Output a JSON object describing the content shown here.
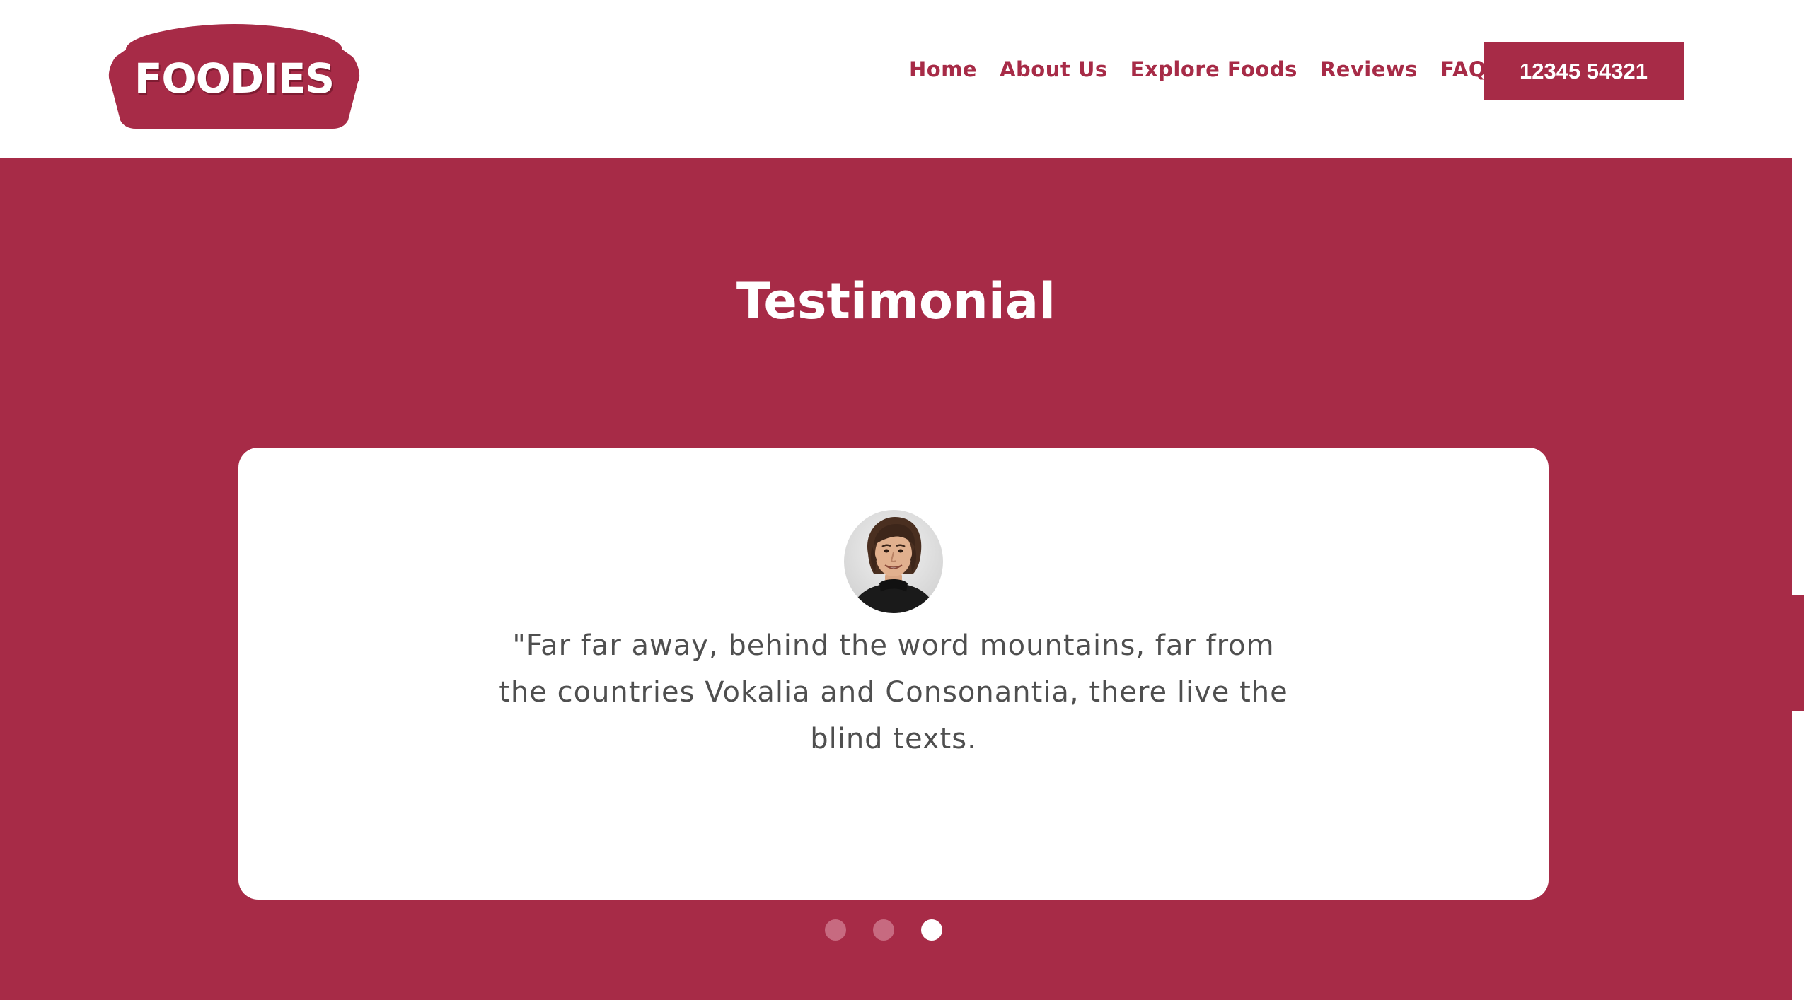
{
  "logo": {
    "text": "FOODIES"
  },
  "nav": {
    "items": [
      {
        "label": "Home"
      },
      {
        "label": "About Us"
      },
      {
        "label": "Explore Foods"
      },
      {
        "label": "Reviews"
      },
      {
        "label": "FAQs"
      }
    ]
  },
  "header": {
    "phone": "12345 54321"
  },
  "testimonial": {
    "title": "Testimonial",
    "quote": "\"Far far away, behind the word mountains, far from the countries Vokalia and Consonantia, there live the blind texts.",
    "active_slide": 3,
    "slide_count": 3
  },
  "colors": {
    "brand": "#a72b47",
    "white": "#ffffff",
    "text": "#4f4f4f"
  }
}
